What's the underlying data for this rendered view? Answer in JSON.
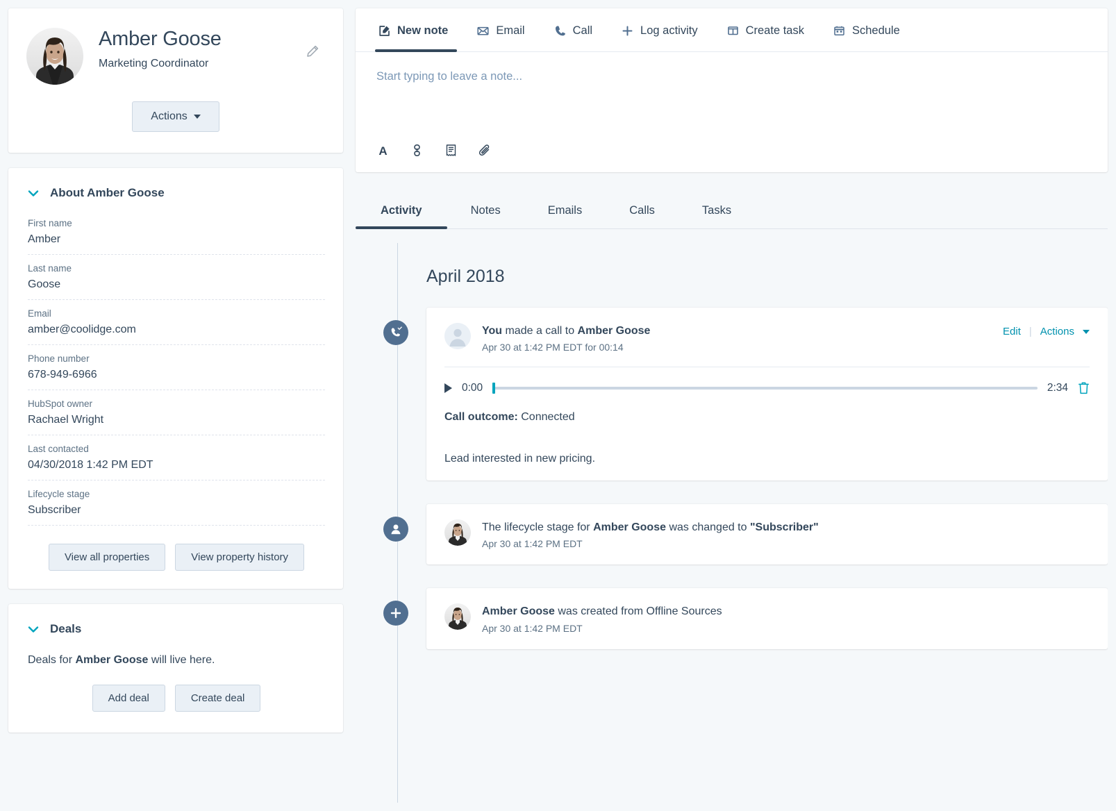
{
  "contact": {
    "name": "Amber Goose",
    "role": "Marketing Coordinator",
    "actions_label": "Actions",
    "edit_icon": "pencil-icon",
    "avatar": "contact-photo"
  },
  "about": {
    "title": "About Amber Goose",
    "properties": [
      {
        "label": "First name",
        "value": "Amber"
      },
      {
        "label": "Last name",
        "value": "Goose"
      },
      {
        "label": "Email",
        "value": "amber@coolidge.com"
      },
      {
        "label": "Phone number",
        "value": "678-949-6966"
      },
      {
        "label": "HubSpot owner",
        "value": "Rachael Wright"
      },
      {
        "label": "Last contacted",
        "value": "04/30/2018 1:42 PM EDT"
      },
      {
        "label": "Lifecycle stage",
        "value": "Subscriber"
      }
    ],
    "view_all_properties": "View all properties",
    "view_property_history": "View property history"
  },
  "deals": {
    "title": "Deals",
    "empty_prefix": "Deals for ",
    "empty_contact": "Amber Goose",
    "empty_suffix": " will live here.",
    "add_deal": "Add deal",
    "create_deal": "Create deal"
  },
  "composer": {
    "tabs": [
      {
        "label": "New note",
        "icon": "note-edit-icon",
        "active": true
      },
      {
        "label": "Email",
        "icon": "envelope-icon",
        "active": false
      },
      {
        "label": "Call",
        "icon": "phone-icon",
        "active": false
      },
      {
        "label": "Log activity",
        "icon": "plus-icon",
        "active": false
      },
      {
        "label": "Create task",
        "icon": "task-board-icon",
        "active": false
      },
      {
        "label": "Schedule",
        "icon": "calendar-icon",
        "active": false
      }
    ],
    "placeholder": "Start typing to leave a note...",
    "toolbar_icons": [
      "font-format-icon",
      "link-icon",
      "snippet-icon",
      "attachment-icon"
    ]
  },
  "activity": {
    "tabs": [
      {
        "label": "Activity",
        "active": true
      },
      {
        "label": "Notes",
        "active": false
      },
      {
        "label": "Emails",
        "active": false
      },
      {
        "label": "Calls",
        "active": false
      },
      {
        "label": "Tasks",
        "active": false
      }
    ],
    "month_heading": "April 2018",
    "events": [
      {
        "icon": "phone-logged-icon",
        "title_prefix": "You",
        "title_mid": " made a call to ",
        "title_bold": "Amber Goose",
        "timestamp": "Apr 30 at 1:42 PM EDT for 00:14",
        "edit_label": "Edit",
        "actions_label": "Actions",
        "player": {
          "current_time": "0:00",
          "total_time": "2:34",
          "progress_percent": 0,
          "delete_icon": "trash-icon",
          "play_icon": "play-icon"
        },
        "outcome_label": "Call outcome:",
        "outcome_value": "Connected",
        "note": "Lead interested in new pricing."
      },
      {
        "icon": "person-icon",
        "title_prefix": "The lifecycle stage for ",
        "title_bold": "Amber Goose",
        "title_mid": " was changed to ",
        "title_bold2": "\"Subscriber\"",
        "timestamp": "Apr 30 at 1:42 PM EDT",
        "avatar": "contact-photo"
      },
      {
        "icon": "plus-icon",
        "title_bold": "Amber Goose",
        "title_mid": " was created from Offline Sources",
        "timestamp": "Apr 30 at 1:42 PM EDT",
        "avatar": "contact-photo"
      }
    ]
  },
  "colors": {
    "page_bg": "#f5f8fa",
    "text": "#33475b",
    "teal": "#00a4bd",
    "link": "#0091ae",
    "muted": "#5c7184",
    "dot": "#516f90",
    "btn_bg": "#eaf0f6",
    "btn_border": "#cbd6e2"
  }
}
